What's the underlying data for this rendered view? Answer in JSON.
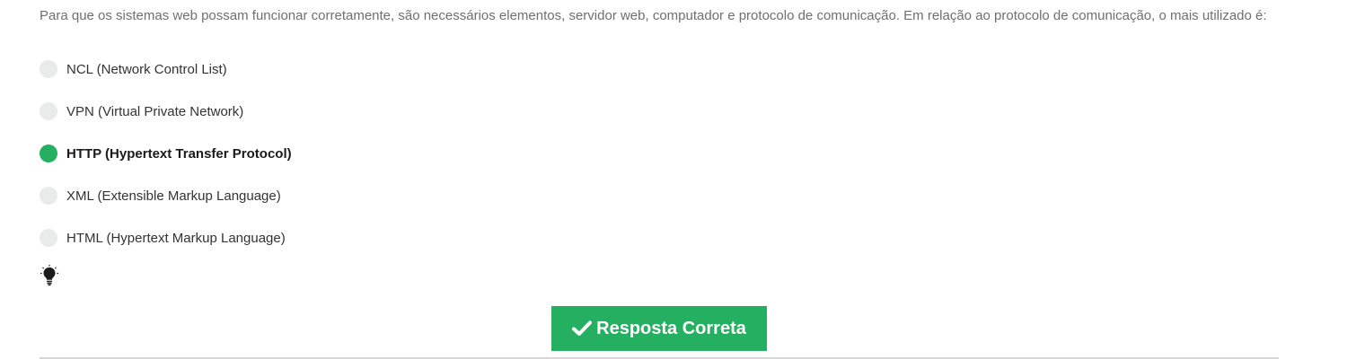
{
  "question": {
    "text": "Para que os sistemas web possam funcionar corretamente, são necessários elementos, servidor web, computador e protocolo de comunicação. Em relação ao protocolo de comunicação, o mais utilizado é:"
  },
  "options": [
    {
      "label": "NCL (Network Control List)",
      "selected": false
    },
    {
      "label": "VPN (Virtual Private Network)",
      "selected": false
    },
    {
      "label": "HTTP (Hypertext Transfer Protocol)",
      "selected": true
    },
    {
      "label": "XML (Extensible Markup Language)",
      "selected": false
    },
    {
      "label": "HTML (Hypertext Markup Language)",
      "selected": false
    }
  ],
  "hint": {
    "icon": "lightbulb-icon"
  },
  "answer_button": {
    "label": "Resposta Correta",
    "icon": "check-icon"
  },
  "colors": {
    "accent": "#24b060",
    "radio_unselected": "#e9eaea",
    "question_text": "#6f6f6f"
  }
}
